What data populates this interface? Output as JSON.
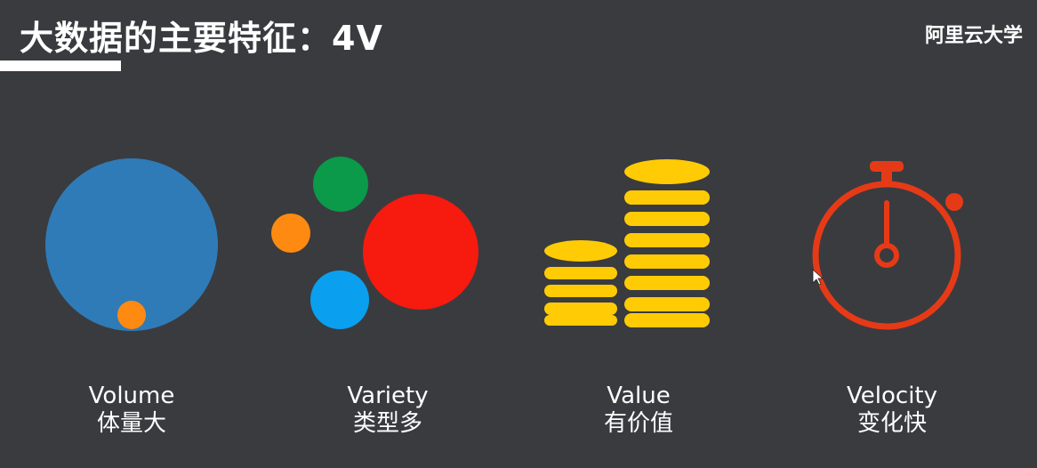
{
  "header": {
    "title": "大数据的主要特征：4V",
    "brand": "阿里云大学"
  },
  "features": [
    {
      "en": "Volume",
      "cn": "体量大",
      "icon": "big-circle-icon"
    },
    {
      "en": "Variety",
      "cn": "类型多",
      "icon": "multicolor-circles-icon"
    },
    {
      "en": "Value",
      "cn": "有价值",
      "icon": "coin-stacks-icon"
    },
    {
      "en": "Velocity",
      "cn": "变化快",
      "icon": "stopwatch-icon"
    }
  ],
  "colors": {
    "background": "#3a3b3f",
    "blue": "#2f7bb7",
    "orange": "#ff8a12",
    "green": "#0a9a4a",
    "red": "#f61a0f",
    "lightblue": "#0aa0ef",
    "gold": "#ffcb05",
    "stopwatch": "#e63a17"
  }
}
